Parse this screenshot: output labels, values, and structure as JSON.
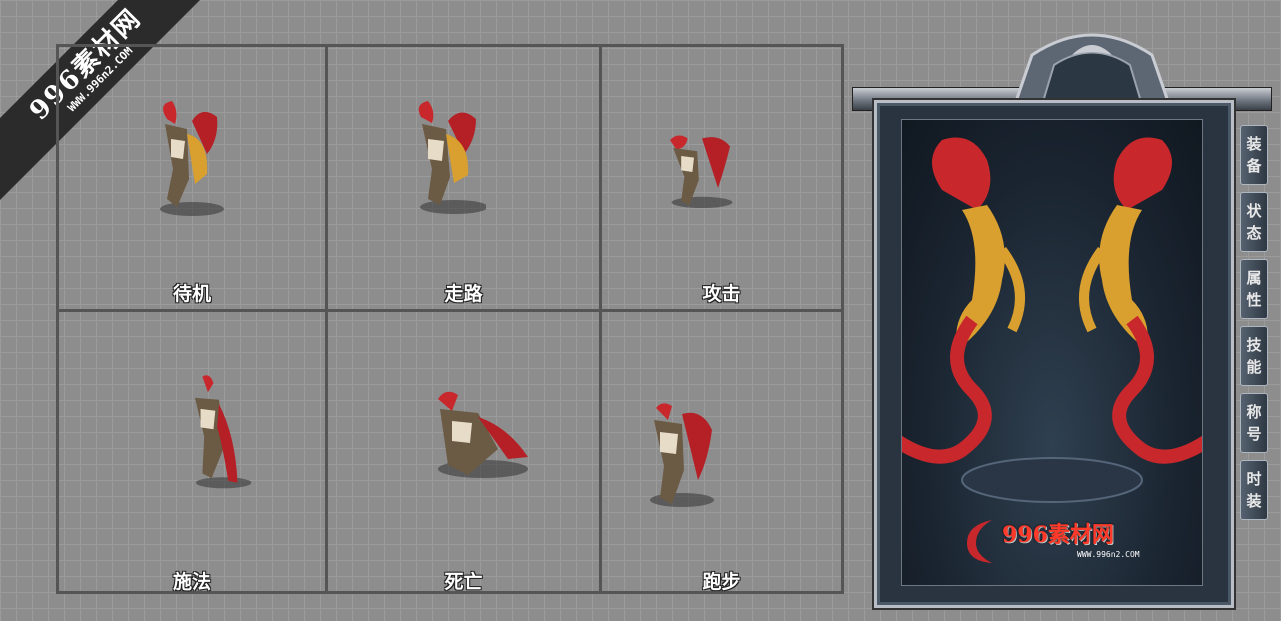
{
  "watermark": {
    "title": "996素材网",
    "url": "WWW.996n2.COM"
  },
  "actions": [
    {
      "label": "待机"
    },
    {
      "label": "走路"
    },
    {
      "label": "攻击"
    },
    {
      "label": "施法"
    },
    {
      "label": "死亡"
    },
    {
      "label": "跑步"
    }
  ],
  "side_tabs": [
    {
      "c1": "装",
      "c2": "备"
    },
    {
      "c1": "状",
      "c2": "态"
    },
    {
      "c1": "属",
      "c2": "性"
    },
    {
      "c1": "技",
      "c2": "能"
    },
    {
      "c1": "称",
      "c2": "号"
    },
    {
      "c1": "时",
      "c2": "装"
    }
  ],
  "logo": {
    "title": "996素材网",
    "url": "WWW.996n2.COM"
  },
  "colors": {
    "panel_bg": "#8d8d8d",
    "grid_line": "#555555",
    "dragon_red": "#c8282c",
    "dragon_gold": "#d9a030"
  }
}
